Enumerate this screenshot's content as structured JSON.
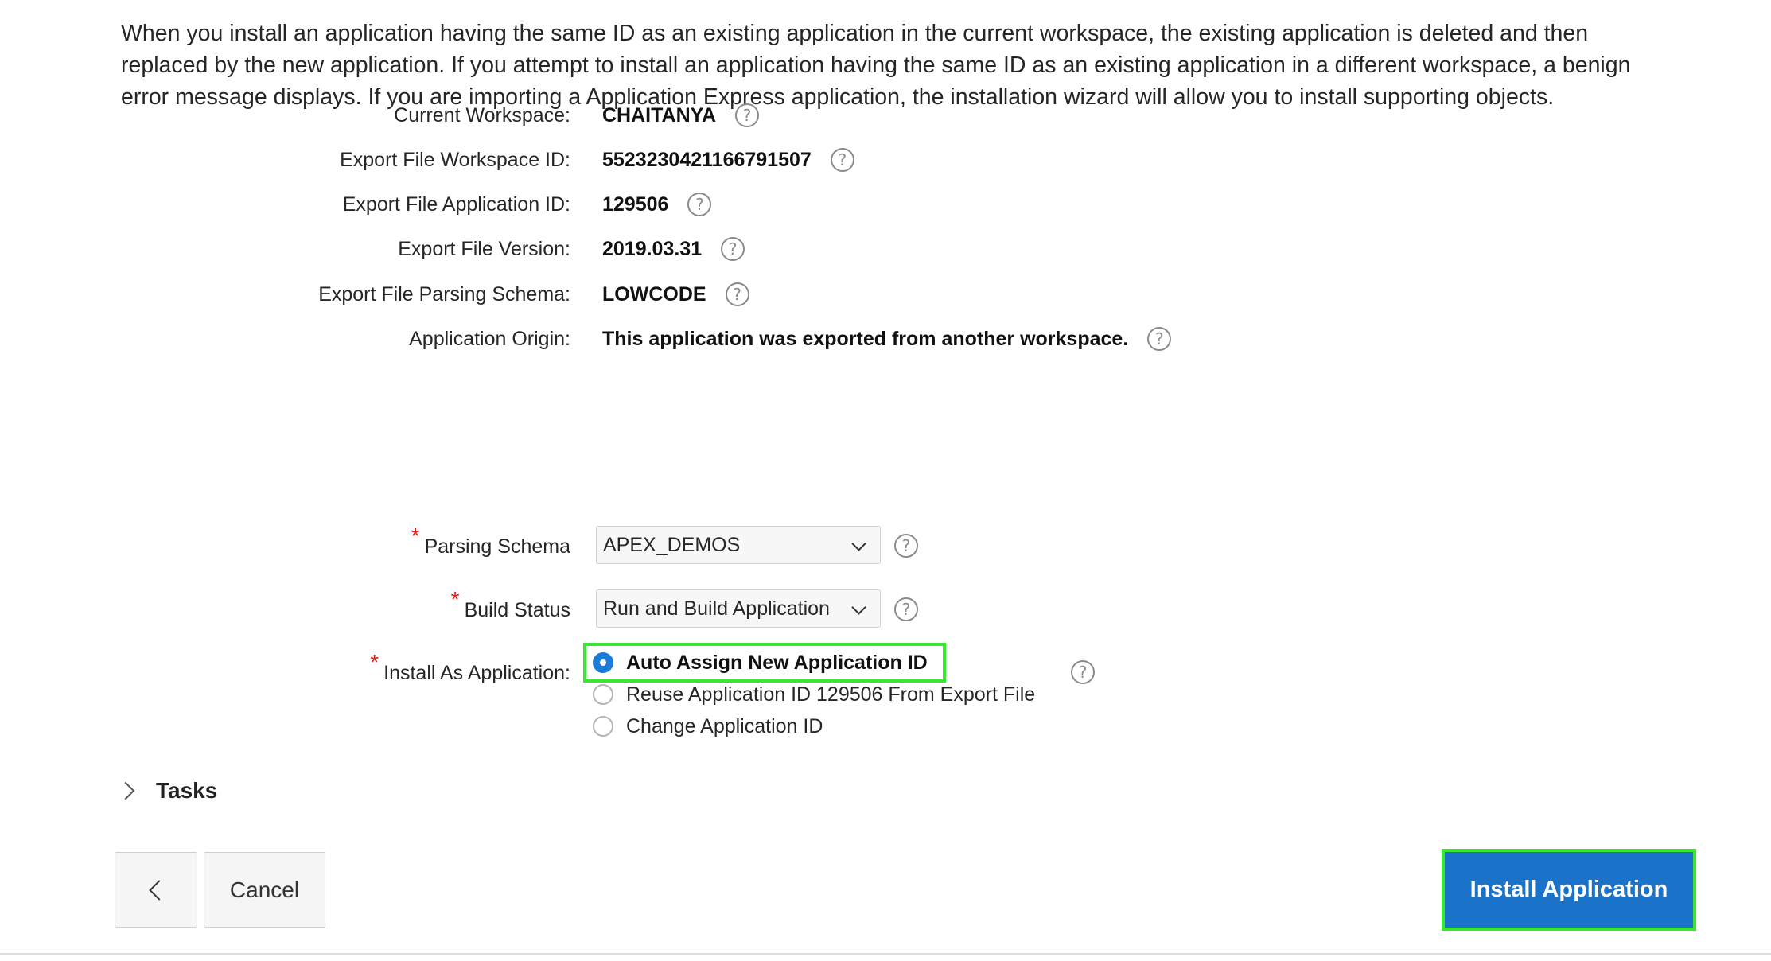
{
  "intro_text": "When you install an application having the same ID as an existing application in the current workspace, the existing application is deleted and then replaced by the new application. If you attempt to install an application having the same ID as an existing application in a different workspace, a benign error message displays. If you are importing a Application Express application, the installation wizard will allow you to install supporting objects.",
  "fields": {
    "current_workspace": {
      "label": "Current Workspace:",
      "value": "CHAITANYA"
    },
    "export_workspace_id": {
      "label": "Export File Workspace ID:",
      "value": "5523230421166791507"
    },
    "export_app_id": {
      "label": "Export File Application ID:",
      "value": "129506"
    },
    "export_version": {
      "label": "Export File Version:",
      "value": "2019.03.31"
    },
    "export_parsing_schema": {
      "label": "Export File Parsing Schema:",
      "value": "LOWCODE"
    },
    "app_origin": {
      "label": "Application Origin:",
      "value": "This application was exported from another workspace."
    }
  },
  "parsing_schema": {
    "label": "Parsing Schema",
    "required_mark": "*",
    "selected": "APEX_DEMOS"
  },
  "build_status": {
    "label": "Build Status",
    "required_mark": "*",
    "selected": "Run and Build Application"
  },
  "install_as": {
    "label": "Install As Application:",
    "required_mark": "*",
    "options": [
      {
        "label": "Auto Assign New Application ID",
        "checked": true
      },
      {
        "label": "Reuse Application ID 129506 From Export File",
        "checked": false
      },
      {
        "label": "Change Application ID",
        "checked": false
      }
    ]
  },
  "help_glyph": "?",
  "tasks_label": "Tasks",
  "buttons": {
    "cancel": "Cancel",
    "install": "Install Application"
  },
  "colors": {
    "accent": "#1a72c9",
    "highlight": "#39e631",
    "required": "#e0201b"
  }
}
